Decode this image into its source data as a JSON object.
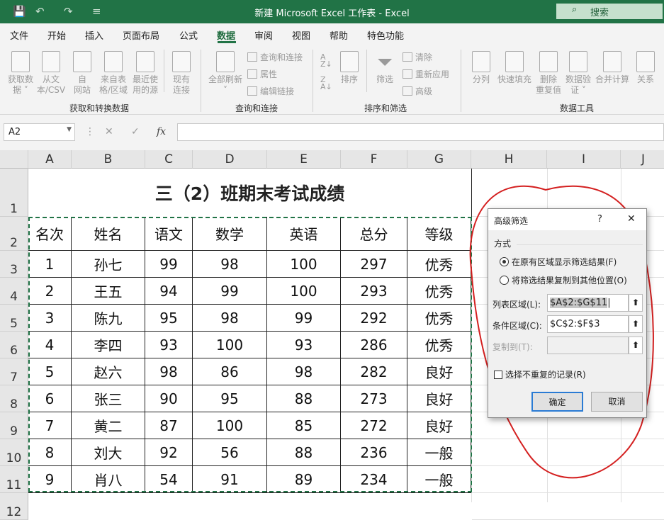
{
  "window": {
    "title": "新建 Microsoft Excel 工作表  -  Excel",
    "search": "搜索"
  },
  "quick_access": {
    "save": "💾",
    "undo": "↶",
    "redo": "↷",
    "customize": "≡"
  },
  "tabs": [
    "文件",
    "开始",
    "插入",
    "页面布局",
    "公式",
    "数据",
    "审阅",
    "视图",
    "帮助",
    "特色功能"
  ],
  "active_tab": "数据",
  "ribbon": {
    "get_data": [
      {
        "l1": "获取数",
        "l2": "据 ˅"
      },
      {
        "l1": "从文",
        "l2": "本/CSV"
      },
      {
        "l1": "自",
        "l2": "网站"
      },
      {
        "l1": "来自表",
        "l2": "格/区域"
      },
      {
        "l1": "最近使",
        "l2": "用的源"
      },
      {
        "l1": "现有",
        "l2": "连接"
      }
    ],
    "group1": "获取和转换数据",
    "refresh": {
      "l1": "全部刷新",
      "l2": "˅"
    },
    "query_small": [
      "查询和连接",
      "属性",
      "编辑链接"
    ],
    "group2": "查询和连接",
    "sort": "排序",
    "filter": "筛选",
    "filter_small": [
      "清除",
      "重新应用",
      "高级"
    ],
    "group3": "排序和筛选",
    "tools": [
      {
        "l1": "分列",
        "l2": ""
      },
      {
        "l1": "快速填充",
        "l2": ""
      },
      {
        "l1": "删除",
        "l2": "重复值"
      },
      {
        "l1": "数据验",
        "l2": "证 ˅"
      },
      {
        "l1": "合并计算",
        "l2": ""
      },
      {
        "l1": "关系",
        "l2": ""
      }
    ],
    "group4": "数据工具"
  },
  "formula_bar": {
    "name_box": "A2",
    "fx": "fx",
    "cancel": "✕",
    "enter": "✓",
    "value": ""
  },
  "columns": [
    "A",
    "B",
    "C",
    "D",
    "E",
    "F",
    "G",
    "H",
    "I",
    "J"
  ],
  "rows": [
    "1",
    "2",
    "3",
    "4",
    "5",
    "6",
    "7",
    "8",
    "9",
    "10",
    "11",
    "12"
  ],
  "sheet": {
    "title": "三（2）班期末考试成绩",
    "headers": [
      "名次",
      "姓名",
      "语文",
      "数学",
      "英语",
      "总分",
      "等级"
    ],
    "data": [
      [
        "1",
        "孙七",
        "99",
        "98",
        "100",
        "297",
        "优秀"
      ],
      [
        "2",
        "王五",
        "94",
        "99",
        "100",
        "293",
        "优秀"
      ],
      [
        "3",
        "陈九",
        "95",
        "98",
        "99",
        "292",
        "优秀"
      ],
      [
        "4",
        "李四",
        "93",
        "100",
        "93",
        "286",
        "优秀"
      ],
      [
        "5",
        "赵六",
        "98",
        "86",
        "98",
        "282",
        "良好"
      ],
      [
        "6",
        "张三",
        "90",
        "95",
        "88",
        "273",
        "良好"
      ],
      [
        "7",
        "黄二",
        "87",
        "100",
        "85",
        "272",
        "良好"
      ],
      [
        "8",
        "刘大",
        "92",
        "56",
        "88",
        "236",
        "一般"
      ],
      [
        "9",
        "肖八",
        "54",
        "91",
        "89",
        "234",
        "一般"
      ]
    ]
  },
  "dialog": {
    "title": "高级筛选",
    "help": "?",
    "close": "✕",
    "section": "方式",
    "option1": "在原有区域显示筛选结果(F)",
    "option2": "将筛选结果复制到其他位置(O)",
    "list_label": "列表区域(L):",
    "list_value": "$A$2:$G$11",
    "criteria_label": "条件区域(C):",
    "criteria_value": "$C$2:$F$3",
    "copy_label": "复制到(T):",
    "copy_value": "",
    "collapse": "⬆",
    "unique": "选择不重复的记录(R)",
    "ok": "确定",
    "cancel": "取消"
  },
  "colors": {
    "accent": "#217346",
    "annotation": "#d42020"
  }
}
